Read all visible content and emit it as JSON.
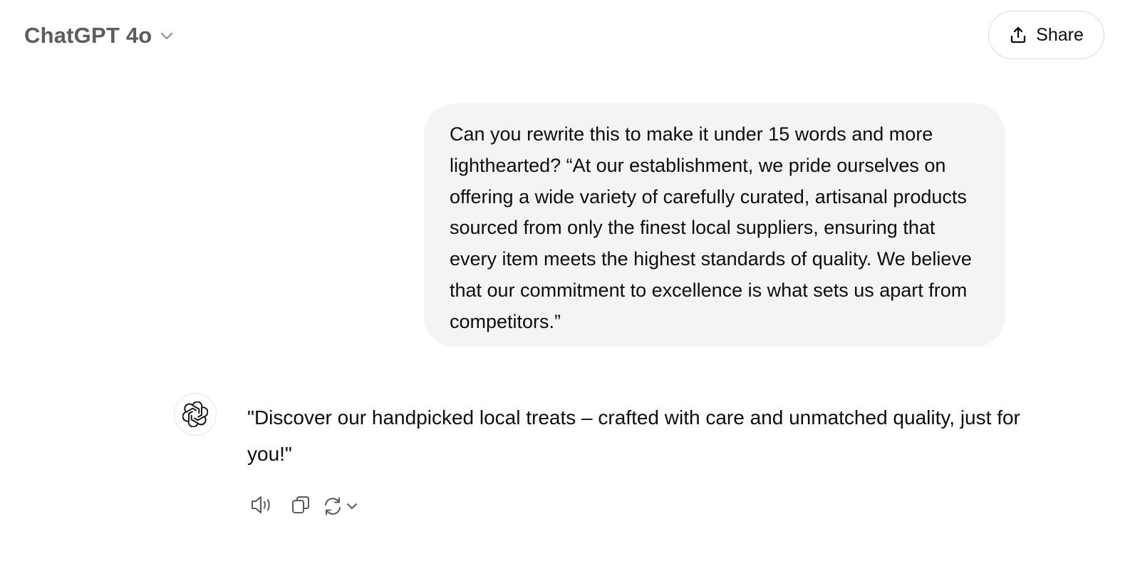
{
  "header": {
    "model_title": "ChatGPT 4o",
    "model_chevron_icon": "chevron-down-icon",
    "share_label": "Share",
    "share_icon": "upload-icon"
  },
  "conversation": {
    "user_message": "Can you rewrite this to make it under 15 words and more lighthearted? “At our establishment, we pride ourselves on offering a wide variety of carefully curated, artisanal products sourced from only the finest local suppliers, ensuring that every item meets the highest standards of quality. We believe that our commitment to excellence is what sets us apart from competitors.”",
    "assistant_avatar_icon": "openai-logo-icon",
    "assistant_message": "\"Discover our handpicked local treats – crafted with care and unmatched quality, just for you!\""
  },
  "message_actions": {
    "read_aloud_icon": "speaker-icon",
    "copy_icon": "copy-icon",
    "regenerate_icon": "refresh-icon",
    "regenerate_menu_icon": "chevron-down-icon"
  },
  "colors": {
    "user_bubble_bg": "#f4f4f4",
    "title_text": "#5d5d5d",
    "icon": "#5d5d5d",
    "border": "#d9d9d9"
  }
}
